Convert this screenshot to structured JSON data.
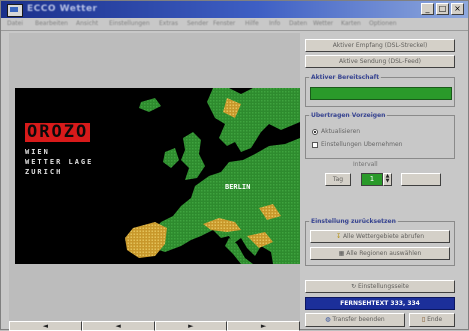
{
  "window": {
    "title": "ECCO Wetter",
    "titlebar_buttons": [
      "_",
      "□",
      "×"
    ]
  },
  "menubar": {
    "items": [
      "Datei",
      "Bearbeiten",
      "Ansicht",
      "Einstellungen",
      "Extras",
      "Sender",
      "Fenster",
      "Hilfe",
      "Info",
      "Daten",
      "Wetter",
      "Karten",
      "Optionen"
    ]
  },
  "map": {
    "logo_text": "OROZO",
    "logo_lines": [
      "WIEN",
      "WETTER LAGE",
      "ZURICH"
    ],
    "city_label": "BERLIN",
    "colors": {
      "land": "#2f8f2f",
      "mountain": "#c99a2a",
      "sea": "#000000"
    }
  },
  "bottom_toolbar": {
    "buttons": [
      "◄",
      "◄",
      "►",
      "►"
    ]
  },
  "sidebar": {
    "btn_top1": "Aktiver Empfang (DSL-Streckel)",
    "btn_top2": "Aktive Sendung (DSL-Feed)",
    "group1_title": "Aktiver Bereitschaft",
    "group1_status_color": "#2a9a2a",
    "group2_title": "Übertragen Vorzeigen",
    "radio1_label": "Aktualisieren",
    "check1_label": "Einstellungen Übernehmen",
    "counter_caption": "Intervall",
    "counter_left_label": "Tag",
    "counter_value": "1",
    "group3_title": "Einstellung zurücksetzen",
    "btn_action1": "Alle Wettergebiete abrufen",
    "btn_action2": "Alle Regionen auswählen",
    "btn_settings": "Einstellungsseite",
    "status_text": "FERNSEHTEXT 333, 334",
    "btn_transfer": "Transfer beenden",
    "btn_exit": "Ende"
  }
}
